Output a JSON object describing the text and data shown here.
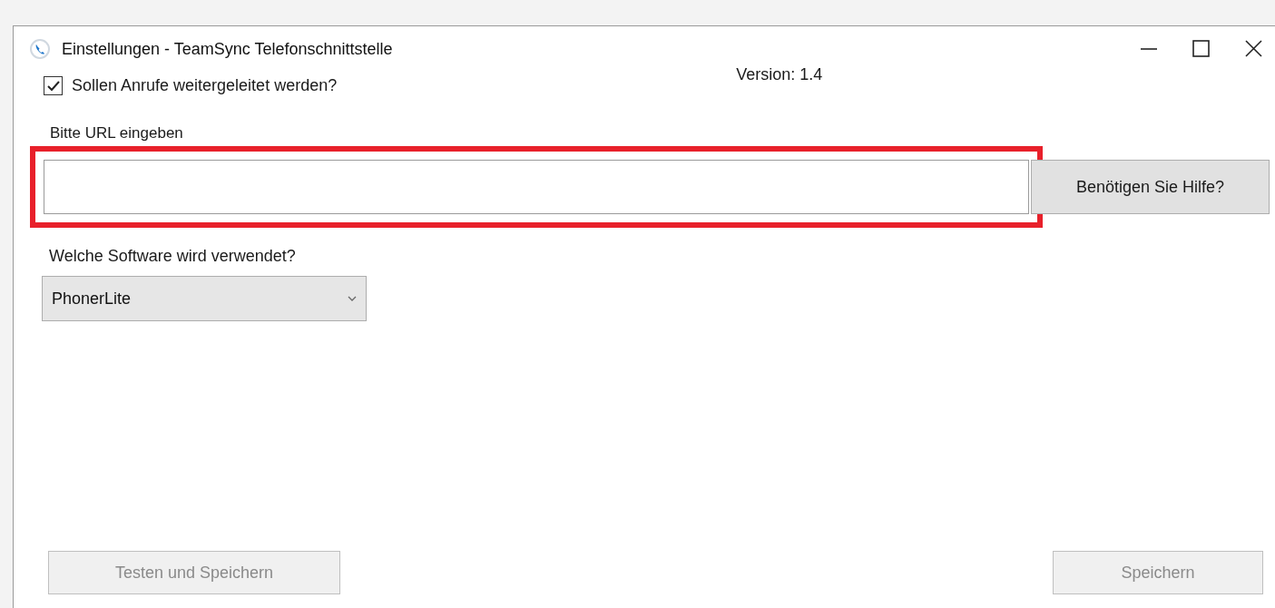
{
  "window": {
    "title": "Einstellungen - TeamSync Telefonschnittstelle"
  },
  "forward_calls": {
    "label": "Sollen Anrufe weitergeleitet werden?",
    "checked": true
  },
  "version": "Version: 1.4",
  "url": {
    "label": "Bitte URL eingeben",
    "highlighted": true
  },
  "help_button": {
    "label": "Benötigen Sie Hilfe?",
    "disabled": false
  },
  "software": {
    "label": "Welche Software wird verwendet?",
    "value": "PhonerLite"
  },
  "buttons": [
    {
      "label": "Testen und Speichern",
      "disabled": true
    },
    {
      "label": "Speichern",
      "disabled": true
    }
  ]
}
